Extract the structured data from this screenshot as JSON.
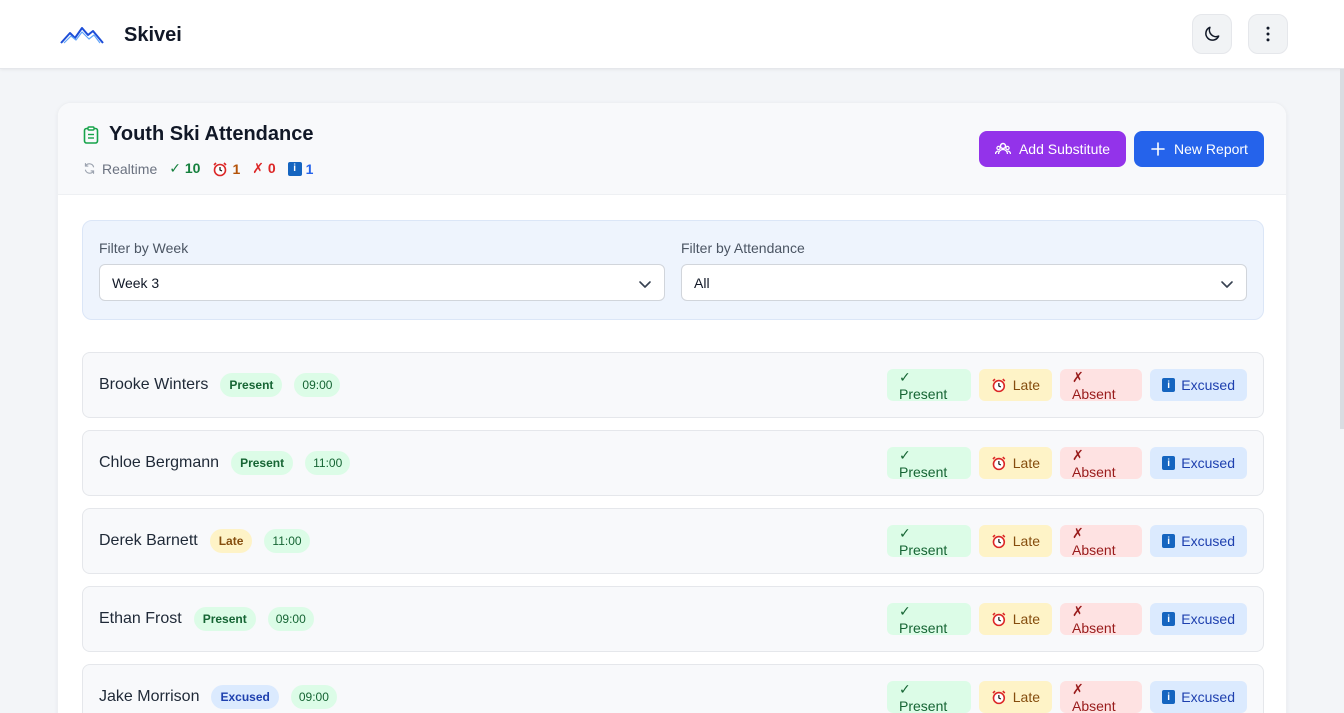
{
  "app": {
    "name": "Skivei"
  },
  "header": {
    "theme_toggle_icon": "moon-icon",
    "menu_icon": "more-vertical-icon"
  },
  "attendance": {
    "title": "Youth Ski Attendance",
    "realtime_label": "Realtime",
    "stats": {
      "present": "✓ 10",
      "late": "1",
      "absent": "✗ 0",
      "excused": "1"
    },
    "add_substitute_label": "Add Substitute",
    "new_report_label": "New Report"
  },
  "filters": {
    "week_label": "Filter by Week",
    "week_value": "Week 3",
    "attendance_label": "Filter by Attendance",
    "attendance_value": "All"
  },
  "action_labels": {
    "present": "✓ Present",
    "late": "Late",
    "absent": "✗ Absent",
    "excused": "Excused"
  },
  "students": [
    {
      "name": "Brooke Winters",
      "status": "Present",
      "time": "09:00"
    },
    {
      "name": "Chloe Bergmann",
      "status": "Present",
      "time": "11:00"
    },
    {
      "name": "Derek Barnett",
      "status": "Late",
      "time": "11:00"
    },
    {
      "name": "Ethan Frost",
      "status": "Present",
      "time": "09:00"
    },
    {
      "name": "Jake Morrison",
      "status": "Excused",
      "time": "09:00"
    }
  ],
  "colors": {
    "primary": "#2563eb",
    "purple": "#9333ea",
    "present": "#dcfce7",
    "late": "#fef3c7",
    "absent": "#fee2e2",
    "excused": "#dbeafe"
  }
}
